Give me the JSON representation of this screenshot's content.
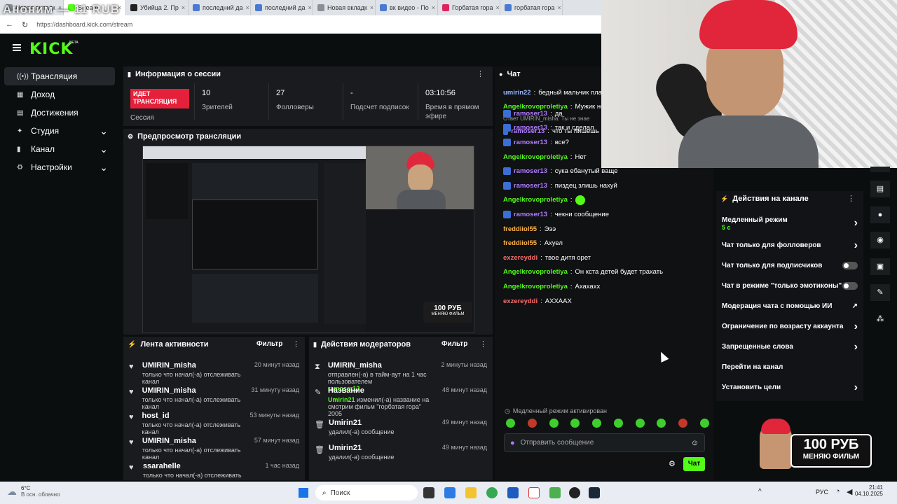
{
  "watermark": "Аноним — 11 RUB",
  "browser": {
    "tabs": [
      {
        "label": "Новая вкладк",
        "color": "#8a8f96"
      },
      {
        "label": "Stream",
        "color": "#53fc18",
        "active": true
      },
      {
        "label": "Убийца 2. Пр",
        "color": "#222222"
      },
      {
        "label": "последний да",
        "color": "#4a7bd0"
      },
      {
        "label": "последний да",
        "color": "#4a7bd0"
      },
      {
        "label": "Новая вкладк",
        "color": "#8a8f96"
      },
      {
        "label": "вк видео - По",
        "color": "#4a7bd0"
      },
      {
        "label": "Горбатая гора",
        "color": "#e0245e"
      },
      {
        "label": "горбатая гора",
        "color": "#4a7bd0"
      }
    ],
    "url": "https://dashboard.kick.com/stream"
  },
  "app": {
    "logo": "KICK",
    "beta": "BETA"
  },
  "sidebar": {
    "items": [
      {
        "label": "Трансляция",
        "icon": "broadcast-icon",
        "glyph": "((•))",
        "active": true,
        "chevron": false
      },
      {
        "label": "Доход",
        "icon": "income-icon",
        "glyph": "▦",
        "chevron": false
      },
      {
        "label": "Достижения",
        "icon": "achievements-icon",
        "glyph": "▤",
        "chevron": false
      },
      {
        "label": "Студия",
        "icon": "studio-icon",
        "glyph": "✦",
        "chevron": true
      },
      {
        "label": "Канал",
        "icon": "channel-icon",
        "glyph": "▮",
        "chevron": true
      },
      {
        "label": "Настройки",
        "icon": "settings-icon",
        "glyph": "⚙",
        "chevron": true
      }
    ]
  },
  "session": {
    "title": "Информация о сессии",
    "live_badge": "ИДЕТ ТРАНСЛЯЦИЯ",
    "session_label": "Сессия",
    "stats": [
      {
        "value": "10",
        "label": "Зрителей"
      },
      {
        "value": "27",
        "label": "Фолловеры"
      },
      {
        "value": "-",
        "label": "Подсчет подписок"
      },
      {
        "value": "03:10:56",
        "label": "Время в прямом эфире"
      }
    ]
  },
  "preview": {
    "title": "Предпросмотр трансляции",
    "overlay_text": "100 РУБ",
    "overlay_sub": "МЕНЯЮ ФИЛЬМ"
  },
  "activity": {
    "title": "Лента активности",
    "filter": "Фильтр",
    "items": [
      {
        "name": "UMIRIN_misha",
        "text": "только что начал(-а) отслеживать канал",
        "time": "20 минут назад"
      },
      {
        "name": "UMIRIN_misha",
        "text": "только что начал(-а) отслеживать канал",
        "time": "31 минуту назад"
      },
      {
        "name": "host_id",
        "text": "только что начал(-а) отслеживать канал",
        "time": "53 минуты назад"
      },
      {
        "name": "UMIRIN_misha",
        "text": "только что начал(-а) отслеживать канал",
        "time": "57 минут назад"
      },
      {
        "name": "ssarahelle",
        "text": "только что начал(-а) отслеживать канал",
        "time": "1 час назад"
      }
    ]
  },
  "modactions": {
    "title": "Действия модераторов",
    "filter": "Фильтр",
    "items": [
      {
        "name": "UMIRIN_misha",
        "icon": "hourglass-icon",
        "glyph": "⧗",
        "text": "отправлен(-а) в тайм-аут на 1 час пользователем",
        "extra": "ramoser13",
        "time": "2 минуты назад"
      },
      {
        "name": "Название",
        "icon": "rename-icon",
        "glyph": "✎",
        "text": "изменил(-а) название на смотрим фильм \"горбатая гора\" 2005",
        "extra": "Umirin21",
        "time": "48 минут назад"
      },
      {
        "name": "Umirin21",
        "icon": "trash-icon",
        "glyph": "🗑",
        "text": "удалил(-а) сообщение",
        "extra": "",
        "time": "49 минут назад"
      },
      {
        "name": "Umirin21",
        "icon": "trash-icon",
        "glyph": "🗑",
        "text": "удалил(-а) сообщение",
        "extra": "",
        "time": "49 минут назад"
      }
    ]
  },
  "chat": {
    "title": "Чат",
    "reply_note": "Ответ UMIRIN_misha: Ты не знае",
    "messages": [
      {
        "user": "umirin22",
        "color": "#9bb7ff",
        "text": "бедный мальчик плаче",
        "badge": false
      },
      {
        "user": "Angelkrovoproletiya",
        "color": "#53fc18",
        "text": "Мужик не д",
        "badge": false
      },
      {
        "user": "ramoser13",
        "color": "#b07cff",
        "text": "что ты пишешь бл",
        "badge": true
      },
      {
        "user": "ramoser13",
        "color": "#b07cff",
        "text": "да",
        "badge": true
      },
      {
        "user": "ramoser13",
        "color": "#b07cff",
        "text": "так и сделал",
        "badge": true
      },
      {
        "user": "ramoser13",
        "color": "#b07cff",
        "text": "все?",
        "badge": true
      },
      {
        "user": "Angelkrovoproletiya",
        "color": "#53fc18",
        "text": "Нет",
        "badge": false
      },
      {
        "user": "ramoser13",
        "color": "#b07cff",
        "text": "сука ебанутый ваще",
        "badge": true
      },
      {
        "user": "ramoser13",
        "color": "#b07cff",
        "text": "пиздец злишь нахуй",
        "badge": true
      },
      {
        "user": "Angelkrovoproletiya",
        "color": "#53fc18",
        "text": "",
        "badge": false,
        "emote": true
      },
      {
        "user": "ramoser13",
        "color": "#b07cff",
        "text": "чекни сообщение",
        "badge": true
      },
      {
        "user": "freddiiol55",
        "color": "#ffb347",
        "text": "Эээ",
        "badge": false
      },
      {
        "user": "freddiiol55",
        "color": "#ffb347",
        "text": "Ахуел",
        "badge": false
      },
      {
        "user": "exzereyddi",
        "color": "#ff6b6b",
        "text": "твое дитя орет",
        "badge": false
      },
      {
        "user": "Angelkrovoproletiya",
        "color": "#53fc18",
        "text": "Он кста детей будет трахать",
        "badge": false
      },
      {
        "user": "Angelkrovoproletiya",
        "color": "#53fc18",
        "text": "Ахахахх",
        "badge": false
      },
      {
        "user": "exzereyddi",
        "color": "#ff6b6b",
        "text": "АХХААХ",
        "badge": false
      }
    ],
    "slow_mode_note": "Медленный режим активирован",
    "input_placeholder": "Отправить сообщение",
    "send_label": "Чат"
  },
  "channel_actions": {
    "title": "Действия на канале",
    "items": [
      {
        "label": "Медленный режим",
        "sub": "5 с",
        "control": "chevron"
      },
      {
        "label": "Чат только для фолловеров",
        "sub": "",
        "control": "chevron"
      },
      {
        "label": "Чат только для подписчиков",
        "sub": "",
        "control": "toggle"
      },
      {
        "label": "Чат в режиме \"только эмотиконы\"",
        "sub": "",
        "control": "toggle"
      },
      {
        "label": "Модерация чата с помощью ИИ",
        "sub": "",
        "control": "external"
      },
      {
        "label": "Ограничение по возрасту аккаунта",
        "sub": "",
        "control": "chevron"
      },
      {
        "label": "Запрещенные слова",
        "sub": "",
        "control": "chevron"
      },
      {
        "label": "Перейти на канал",
        "sub": "",
        "control": "none"
      },
      {
        "label": "Установить цели",
        "sub": "",
        "control": "chevron"
      }
    ]
  },
  "overlay": {
    "price": "100 РУБ",
    "caption": "МЕНЯЮ ФИЛЬМ"
  },
  "taskbar": {
    "weather_temp": "6°C",
    "weather_desc": "В осн. облачно",
    "search": "Поиск",
    "lang": "РУС",
    "time": "21:41",
    "date": "04.10.2025"
  }
}
